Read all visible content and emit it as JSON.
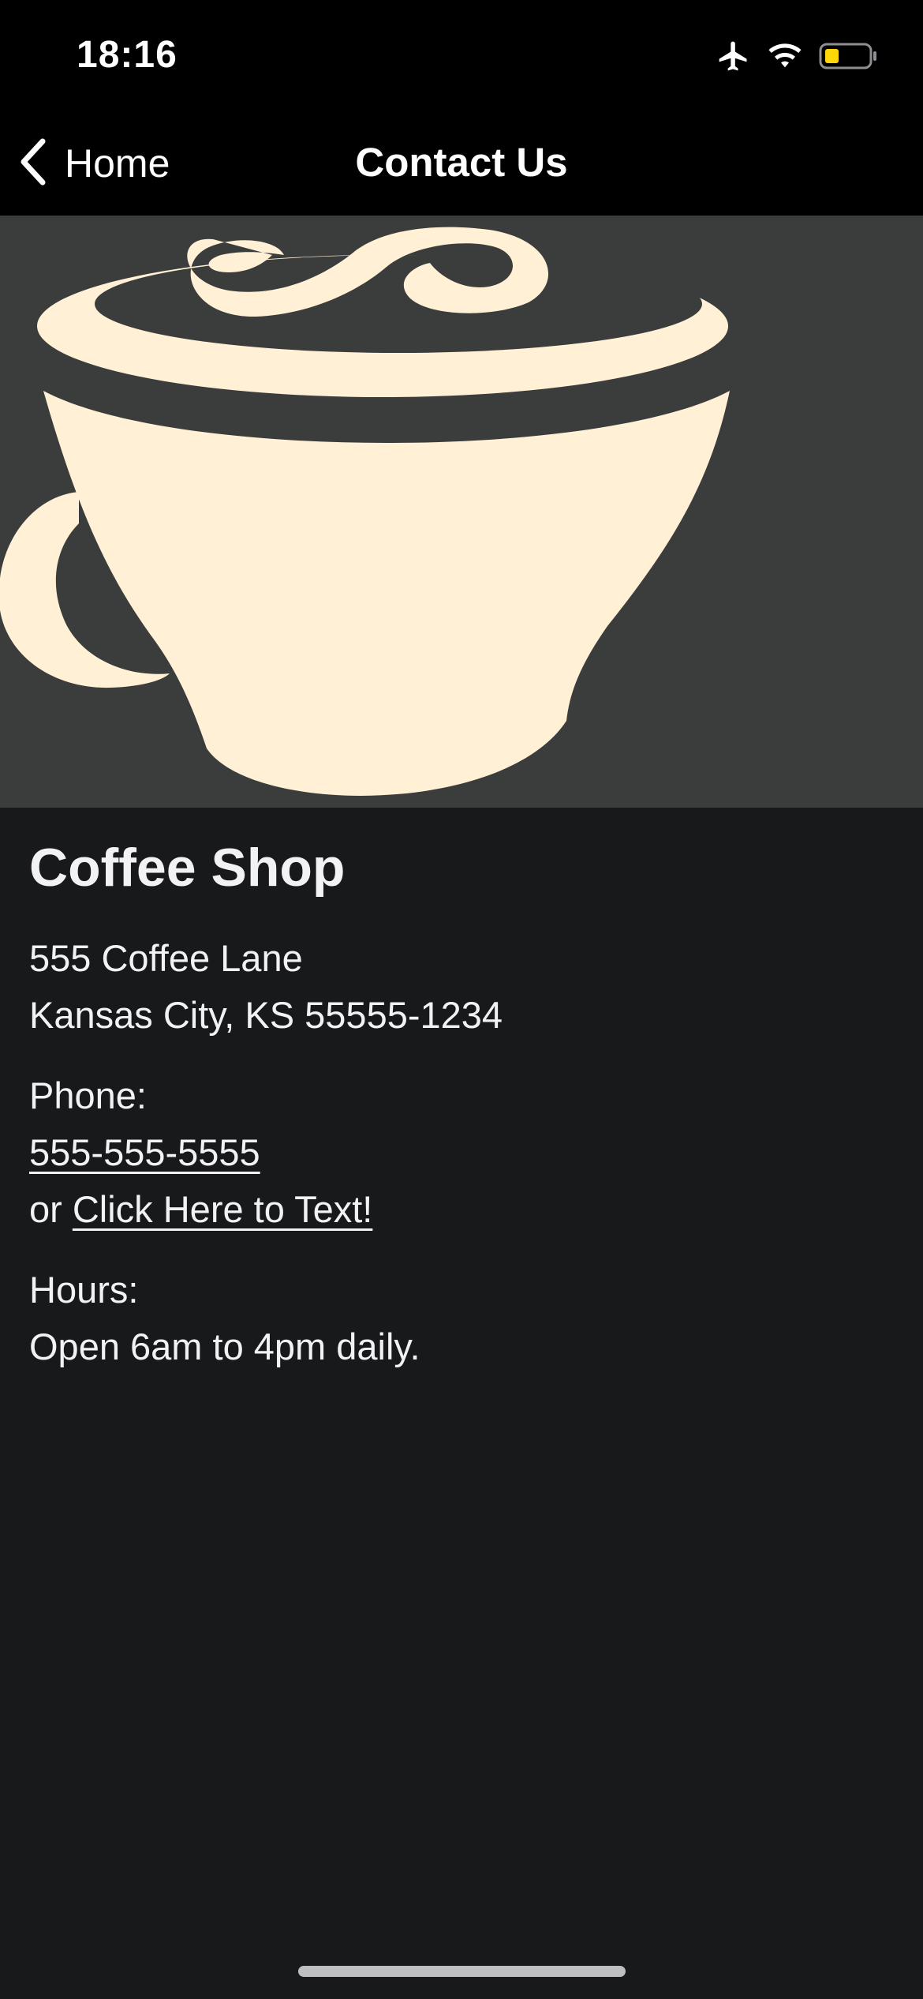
{
  "status_bar": {
    "time": "18:16",
    "icons": [
      "airplane-icon",
      "wifi-icon",
      "battery-icon"
    ],
    "battery_color": "#ffd60a"
  },
  "nav": {
    "back_label": "Home",
    "title": "Contact Us"
  },
  "hero": {
    "image": "coffee-cup-illustration",
    "background_color": "#3b3c3c",
    "cup_color": "#fff0d6"
  },
  "contact": {
    "shop_name": "Coffee Shop",
    "address_line1": "555 Coffee Lane",
    "address_line2": "Kansas City, KS 55555-1234",
    "phone_label": "Phone:",
    "phone_number": "555-555-5555",
    "text_prefix": "or ",
    "text_link": "Click Here to Text!",
    "hours_label": "Hours:",
    "hours_value": "Open 6am to 4pm daily."
  },
  "colors": {
    "background": "#18191b",
    "text": "#f2f2f4",
    "bar": "#000000"
  }
}
